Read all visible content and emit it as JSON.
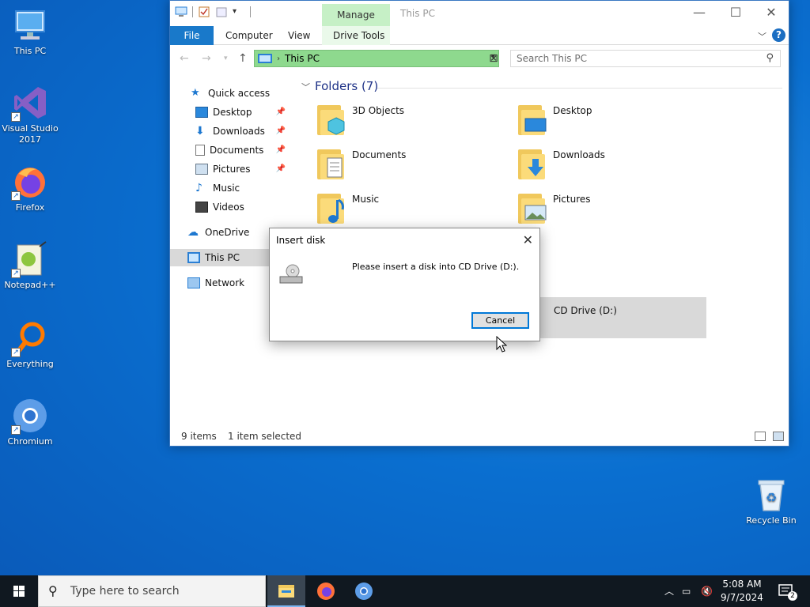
{
  "desktop": {
    "icons": [
      {
        "label": "This PC"
      },
      {
        "label": "Visual Studio 2017"
      },
      {
        "label": "Firefox"
      },
      {
        "label": "Notepad++"
      },
      {
        "label": "Everything"
      },
      {
        "label": "Chromium"
      },
      {
        "label": "Recycle Bin"
      }
    ]
  },
  "window": {
    "title": "This PC",
    "manage_tab": "Manage",
    "ribbon_tabs": [
      "File",
      "Computer",
      "View",
      "Drive Tools"
    ],
    "address_path": "This PC",
    "search_placeholder": "Search This PC",
    "nav": [
      {
        "label": "Quick access",
        "icon": "star-icon"
      },
      {
        "label": "Desktop",
        "icon": "desktop-icon",
        "pinned": true
      },
      {
        "label": "Downloads",
        "icon": "download-icon",
        "pinned": true
      },
      {
        "label": "Documents",
        "icon": "document-icon",
        "pinned": true
      },
      {
        "label": "Pictures",
        "icon": "pictures-icon",
        "pinned": true
      },
      {
        "label": "Music",
        "icon": "music-icon"
      },
      {
        "label": "Videos",
        "icon": "video-icon"
      },
      {
        "label": "OneDrive",
        "icon": "cloud-icon"
      },
      {
        "label": "This PC",
        "icon": "computer-icon"
      },
      {
        "label": "Network",
        "icon": "network-icon"
      }
    ],
    "folders_header": "Folders (7)",
    "folders": [
      "3D Objects",
      "Desktop",
      "Documents",
      "Downloads",
      "Music",
      "Pictures"
    ],
    "selected_drive": "CD Drive (D:)",
    "status": {
      "items": "9 items",
      "selected": "1 item selected"
    }
  },
  "dialog": {
    "title": "Insert disk",
    "message": "Please insert a disk into CD Drive (D:).",
    "cancel_label": "Cancel"
  },
  "taskbar": {
    "search_placeholder": "Type here to search",
    "time": "5:08 AM",
    "date": "9/7/2024",
    "notification_count": "2"
  },
  "colors": {
    "accent": "#0078d7",
    "manage_tab": "#c6f0c6",
    "address_highlight": "#8ed98e",
    "desktop": "#0a6fd0"
  }
}
